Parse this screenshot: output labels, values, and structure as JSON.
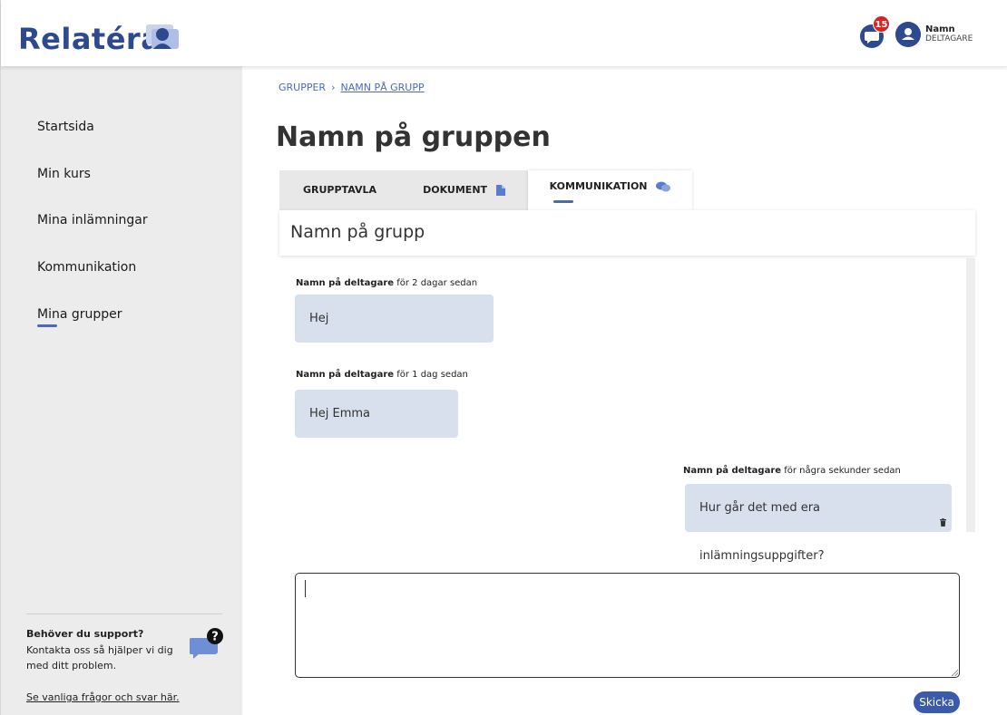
{
  "app": {
    "logo_text": "Relatéra",
    "brand_color": "#2d4a8f",
    "accent_color": "#4a6ab8"
  },
  "header": {
    "notification_count": "15",
    "user": {
      "name": "Namn",
      "role": "DELTAGARE"
    },
    "icons": {
      "chat": "chat-icon",
      "avatar": "user-avatar-icon"
    }
  },
  "sidebar": {
    "items": [
      {
        "label": "Startsida"
      },
      {
        "label": "Min kurs"
      },
      {
        "label": "Mina inlämningar"
      },
      {
        "label": "Kommunikation"
      },
      {
        "label": "Mina grupper",
        "active": true
      }
    ],
    "support": {
      "title": "Behöver du support?",
      "text": "Kontakta oss så hjälper vi dig med ditt problem.",
      "faq_link": "Se vanliga frågor och svar här."
    }
  },
  "breadcrumb": {
    "parent": "GRUPPER",
    "separator": "›",
    "current": "NAMN PÅ GRUPP"
  },
  "page_title": "Namn på gruppen",
  "tabs": [
    {
      "label": "GRUPPTAVLA"
    },
    {
      "label": "DOKUMENT",
      "icon": "document-icon"
    },
    {
      "label": "KOMMUNIKATION",
      "icon": "chat-bubbles-icon",
      "active": true
    }
  ],
  "group": {
    "name": "Namn på grupp"
  },
  "messages": [
    {
      "author": "Namn på deltagare",
      "time": "för 2 dagar sedan",
      "text": "Hej"
    },
    {
      "author": "Namn på deltagare",
      "time": "för 1 dag sedan",
      "text": "Hej Emma"
    },
    {
      "author": "Namn på deltagare",
      "time": "för några sekunder sedan",
      "text": "Hur går det med era inlämningsuppgifter?",
      "own": true
    }
  ],
  "compose": {
    "value": "",
    "send_label": "Skicka"
  }
}
